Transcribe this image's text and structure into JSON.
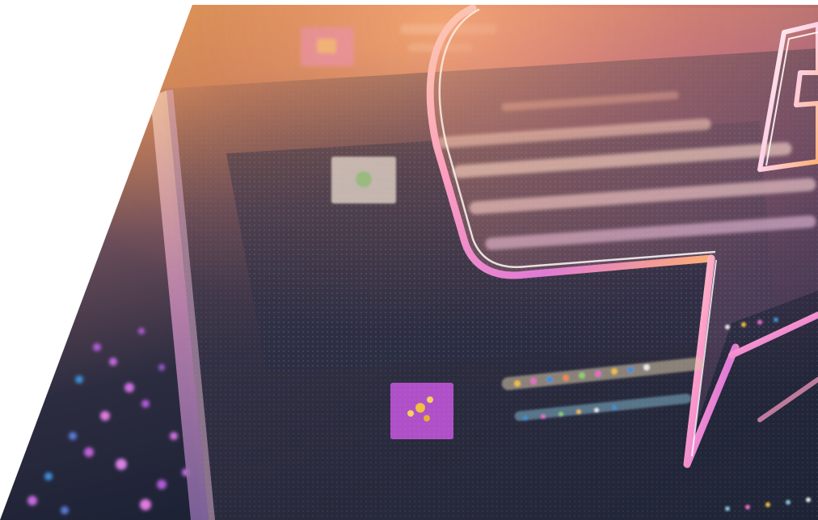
{
  "image": {
    "subject": "abstract-chat-ui-illustration",
    "palette": {
      "page_background": "#ffffff",
      "warm_gold": "#e2a24a",
      "peach": "#f0a070",
      "magenta_pink": "#e86ac8",
      "deep_navy": "#1c2236",
      "violet": "#b05cd8",
      "cyan_blue": "#3f8fd8"
    },
    "icons": [
      "chat-bubble-icon",
      "letter-glyph-icon",
      "message-avatar-icon"
    ]
  }
}
